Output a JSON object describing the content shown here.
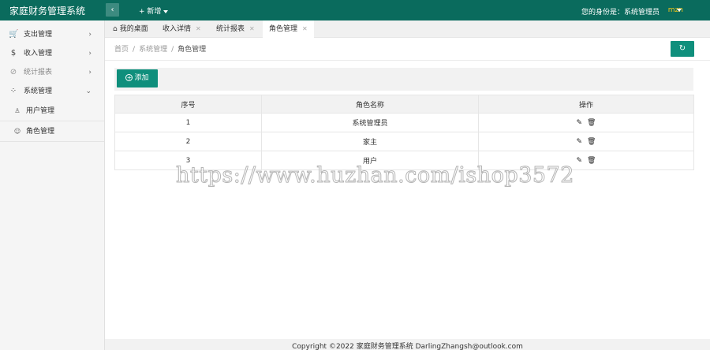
{
  "header": {
    "app_title": "家庭财务管理系统",
    "collapse_icon": "‹",
    "new_label": "+ 新增",
    "identity_label": "您的身份是：系统管理员",
    "username": "mzn",
    "colors": {
      "bar": "#0a6b5d",
      "accent": "#0f8f7c",
      "username": "#f5c518"
    }
  },
  "sidebar": {
    "items": [
      {
        "label": "支出管理",
        "icon": "cart-icon",
        "glyph": "🛒"
      },
      {
        "label": "收入管理",
        "icon": "dollar-icon",
        "glyph": "$"
      },
      {
        "label": "统计报表",
        "icon": "check-circle-icon",
        "glyph": "⊘"
      },
      {
        "label": "系统管理",
        "icon": "grid-icon",
        "glyph": "⁘"
      }
    ],
    "sub_items": [
      {
        "label": "用户管理",
        "icon": "user-icon",
        "glyph": "♙"
      },
      {
        "label": "角色管理",
        "icon": "role-icon",
        "glyph": "☺"
      }
    ]
  },
  "tabs": [
    {
      "label": "我的桌面"
    },
    {
      "label": "收入详情"
    },
    {
      "label": "统计报表"
    },
    {
      "label": "角色管理"
    }
  ],
  "breadcrumb": {
    "home": "首页",
    "parent": "系统管理",
    "current": "角色管理"
  },
  "toolbar": {
    "add_label": "添加"
  },
  "table": {
    "headers": [
      "序号",
      "角色名称",
      "操作"
    ],
    "rows": [
      {
        "idx": "1",
        "name": "系统管理员"
      },
      {
        "idx": "2",
        "name": "家主"
      },
      {
        "idx": "3",
        "name": "用户"
      }
    ]
  },
  "footer": {
    "text": "Copyright ©2022 家庭财务管理系统 DarlingZhangsh@outlook.com"
  },
  "watermark": {
    "text": "https://www.huzhan.com/ishop3572"
  }
}
